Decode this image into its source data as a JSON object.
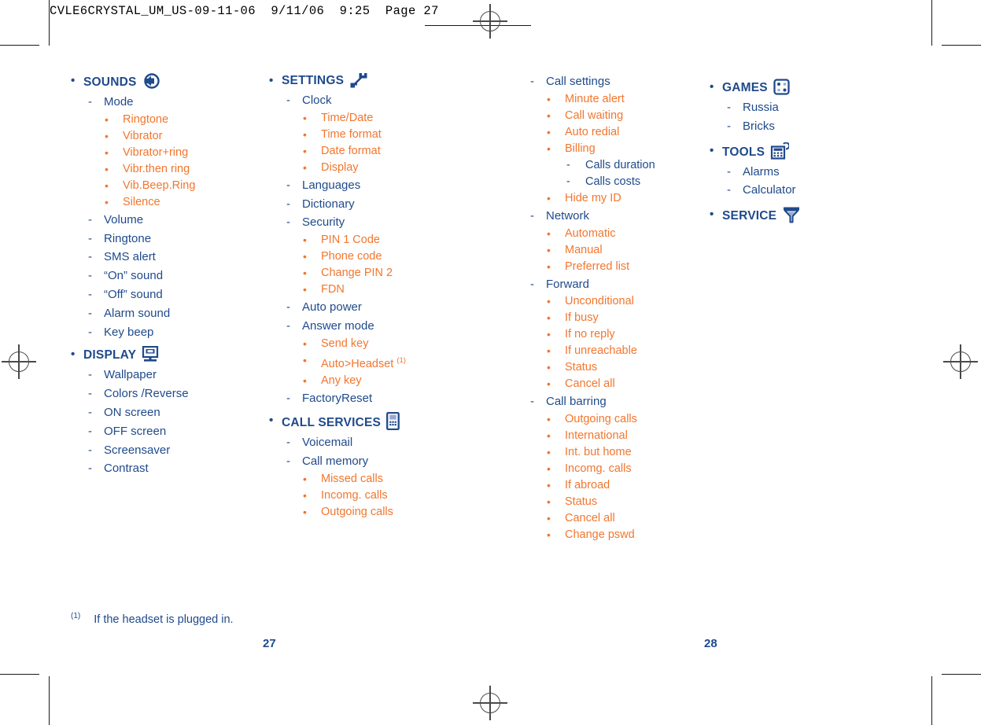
{
  "print_header": {
    "text": "CVLE6CRYSTAL_UM_US-09-11-06  9/11/06  9:25  Page 27"
  },
  "colors": {
    "navy": "#1F4A8C",
    "orange": "#F2762E",
    "rule": "#000000"
  },
  "markers": {
    "bullet": "•",
    "dash": "-"
  },
  "columns": [
    {
      "id": "col1",
      "nodes": [
        {
          "level": 0,
          "label": "SOUNDS",
          "icon": "speaker-icon"
        },
        {
          "level": 1,
          "label": "Mode"
        },
        {
          "level": 2,
          "label": "Ringtone"
        },
        {
          "level": 2,
          "label": "Vibrator"
        },
        {
          "level": 2,
          "label": "Vibrator+ring"
        },
        {
          "level": 2,
          "label": "Vibr.then ring"
        },
        {
          "level": 2,
          "label": "Vib.Beep.Ring"
        },
        {
          "level": 2,
          "label": "Silence"
        },
        {
          "level": 1,
          "label": "Volume"
        },
        {
          "level": 1,
          "label": "Ringtone"
        },
        {
          "level": 1,
          "label": "SMS alert"
        },
        {
          "level": 1,
          "label": "“On” sound"
        },
        {
          "level": 1,
          "label": "“Off” sound"
        },
        {
          "level": 1,
          "label": "Alarm sound"
        },
        {
          "level": 1,
          "label": "Key beep"
        },
        {
          "level": 0,
          "label": "DISPLAY",
          "icon": "monitor-icon"
        },
        {
          "level": 1,
          "label": "Wallpaper"
        },
        {
          "level": 1,
          "label": "Colors /Reverse"
        },
        {
          "level": 1,
          "label": "ON screen"
        },
        {
          "level": 1,
          "label": "OFF screen"
        },
        {
          "level": 1,
          "label": "Screensaver"
        },
        {
          "level": 1,
          "label": "Contrast"
        }
      ]
    },
    {
      "id": "col2",
      "nodes": [
        {
          "level": 0,
          "label": "SETTINGS",
          "icon": "wrench-icon"
        },
        {
          "level": 1,
          "label": "Clock"
        },
        {
          "level": 2,
          "label": "Time/Date"
        },
        {
          "level": 2,
          "label": "Time format"
        },
        {
          "level": 2,
          "label": "Date format"
        },
        {
          "level": 2,
          "label": "Display"
        },
        {
          "level": 1,
          "label": "Languages"
        },
        {
          "level": 1,
          "label": "Dictionary"
        },
        {
          "level": 1,
          "label": "Security"
        },
        {
          "level": 2,
          "label": "PIN 1 Code"
        },
        {
          "level": 2,
          "label": "Phone code"
        },
        {
          "level": 2,
          "label": "Change PIN 2"
        },
        {
          "level": 2,
          "label": "FDN"
        },
        {
          "level": 1,
          "label": "Auto power"
        },
        {
          "level": 1,
          "label": "Answer mode"
        },
        {
          "level": 2,
          "label": "Send key"
        },
        {
          "level": 2,
          "label": "Auto>Headset",
          "footnote": "(1)"
        },
        {
          "level": 2,
          "label": "Any key"
        },
        {
          "level": 1,
          "label": "FactoryReset"
        },
        {
          "level": 0,
          "label": "CALL SERVICES",
          "icon": "phone-icon"
        },
        {
          "level": 1,
          "label": "Voicemail"
        },
        {
          "level": 1,
          "label": "Call memory"
        },
        {
          "level": 2,
          "label": "Missed calls"
        },
        {
          "level": 2,
          "label": "Incomg. calls"
        },
        {
          "level": 2,
          "label": "Outgoing calls"
        }
      ]
    },
    {
      "id": "col3",
      "nodes": [
        {
          "level": 1,
          "label": "Call settings"
        },
        {
          "level": 2,
          "label": "Minute alert"
        },
        {
          "level": 2,
          "label": "Call waiting"
        },
        {
          "level": 2,
          "label": "Auto redial"
        },
        {
          "level": 2,
          "label": "Billing"
        },
        {
          "level": 3,
          "label": "Calls duration"
        },
        {
          "level": 3,
          "label": "Calls costs"
        },
        {
          "level": 2,
          "label": "Hide my ID"
        },
        {
          "level": 1,
          "label": "Network"
        },
        {
          "level": 2,
          "label": "Automatic"
        },
        {
          "level": 2,
          "label": "Manual"
        },
        {
          "level": 2,
          "label": "Preferred list"
        },
        {
          "level": 1,
          "label": "Forward"
        },
        {
          "level": 2,
          "label": "Unconditional"
        },
        {
          "level": 2,
          "label": "If busy"
        },
        {
          "level": 2,
          "label": "If no reply"
        },
        {
          "level": 2,
          "label": "If unreachable"
        },
        {
          "level": 2,
          "label": "Status"
        },
        {
          "level": 2,
          "label": "Cancel all"
        },
        {
          "level": 1,
          "label": "Call barring"
        },
        {
          "level": 2,
          "label": "Outgoing calls"
        },
        {
          "level": 2,
          "label": "International"
        },
        {
          "level": 2,
          "label": "Int. but home"
        },
        {
          "level": 2,
          "label": "Incomg. calls"
        },
        {
          "level": 2,
          "label": "If abroad"
        },
        {
          "level": 2,
          "label": "Status"
        },
        {
          "level": 2,
          "label": "Cancel all"
        },
        {
          "level": 2,
          "label": "Change pswd"
        }
      ]
    },
    {
      "id": "col4",
      "nodes": [
        {
          "level": 0,
          "label": "GAMES",
          "icon": "dice-icon"
        },
        {
          "level": 1,
          "label": "Russia"
        },
        {
          "level": 1,
          "label": "Bricks"
        },
        {
          "level": 0,
          "label": "TOOLS",
          "icon": "calculator-icon"
        },
        {
          "level": 1,
          "label": "Alarms"
        },
        {
          "level": 1,
          "label": "Calculator"
        },
        {
          "level": 0,
          "label": "SERVICE",
          "icon": "antenna-icon"
        }
      ]
    }
  ],
  "footnote": {
    "marker": "(1)",
    "text": "If the headset is plugged in."
  },
  "folios": {
    "left": "27",
    "right": "28"
  }
}
